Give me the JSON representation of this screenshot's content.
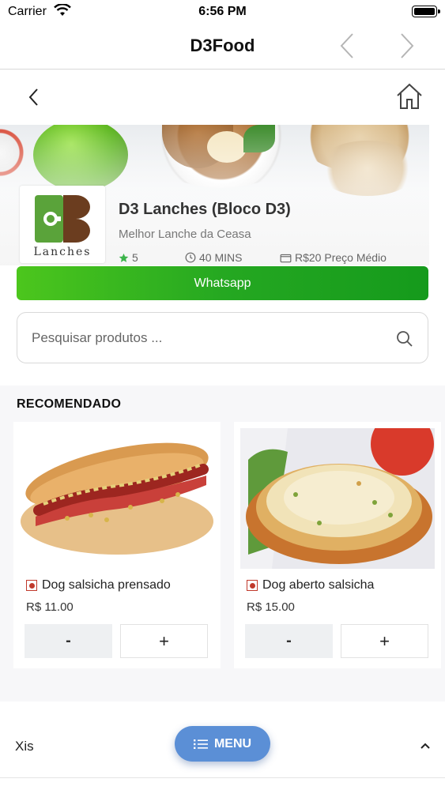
{
  "status_bar": {
    "carrier": "Carrier",
    "time": "6:56 PM"
  },
  "app_bar": {
    "title": "D3Food"
  },
  "store": {
    "name": "D3 Lanches (Bloco D3)",
    "subtitle": "Melhor Lanche da Ceasa",
    "logo_text": "Lanches",
    "rating": "5",
    "delivery_time": "40 MINS",
    "avg_price": "R$20 Preço Médio"
  },
  "whatsapp": {
    "label": "Whatsapp",
    "color": "#25a821"
  },
  "search": {
    "placeholder": "Pesquisar produtos ..."
  },
  "recommended": {
    "title": "RECOMENDADO",
    "products": [
      {
        "name": "Dog salsicha prensado",
        "price": "R$ 11.00",
        "minus_label": "-",
        "plus_label": "+"
      },
      {
        "name": "Dog aberto salsicha",
        "price": "R$ 15.00",
        "minus_label": "-",
        "plus_label": "+"
      }
    ]
  },
  "category": {
    "label": "Xis"
  },
  "menu_button": {
    "label": "MENU",
    "color": "#5b8fd6"
  },
  "icons": [
    "wifi-icon",
    "battery-icon",
    "back-arrow-icon",
    "forward-arrow-icon",
    "chevron-left-icon",
    "home-icon",
    "star-icon",
    "clock-icon",
    "wallet-icon",
    "search-icon",
    "chevron-up-icon",
    "list-icon"
  ]
}
